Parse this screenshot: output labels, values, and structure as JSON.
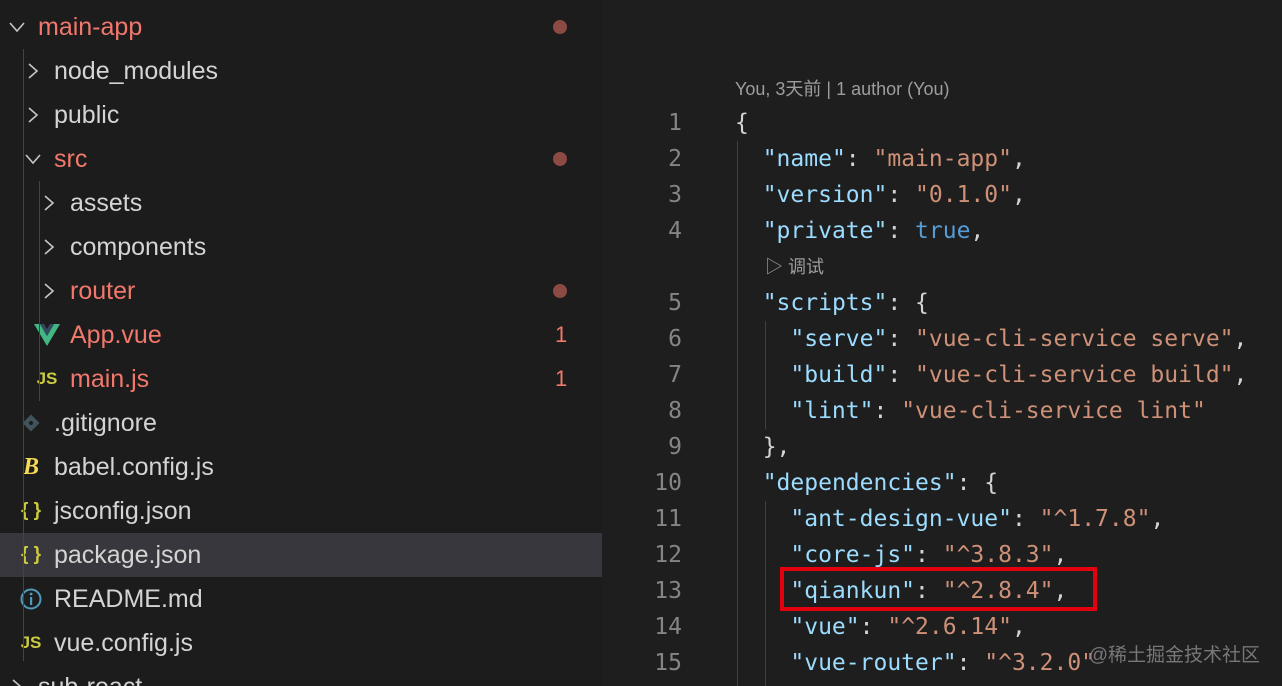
{
  "explorer": {
    "items": [
      {
        "name": "main-app",
        "kind": "folder-open",
        "level": 0,
        "modified": true,
        "dot": true
      },
      {
        "name": "node_modules",
        "kind": "folder",
        "level": 1
      },
      {
        "name": "public",
        "kind": "folder",
        "level": 1
      },
      {
        "name": "src",
        "kind": "folder-open",
        "level": 1,
        "modified": true,
        "dot": true
      },
      {
        "name": "assets",
        "kind": "folder",
        "level": 2
      },
      {
        "name": "components",
        "kind": "folder",
        "level": 2
      },
      {
        "name": "router",
        "kind": "folder",
        "level": 2,
        "modified": true,
        "dot": true
      },
      {
        "name": "App.vue",
        "kind": "vue",
        "level": 2,
        "modified": true,
        "count": "1"
      },
      {
        "name": "main.js",
        "kind": "js",
        "level": 2,
        "modified": true,
        "count": "1"
      },
      {
        "name": ".gitignore",
        "kind": "git",
        "level": 1
      },
      {
        "name": "babel.config.js",
        "kind": "babel",
        "level": 1
      },
      {
        "name": "jsconfig.json",
        "kind": "json",
        "level": 1
      },
      {
        "name": "package.json",
        "kind": "json",
        "level": 1,
        "selected": true
      },
      {
        "name": "README.md",
        "kind": "info",
        "level": 1
      },
      {
        "name": "vue.config.js",
        "kind": "js",
        "level": 1
      },
      {
        "name": "sub-react",
        "kind": "folder",
        "level": 0
      }
    ],
    "icon_glyphs": {
      "js": "JS",
      "json": "{ }",
      "info": "i",
      "babel": "B"
    }
  },
  "editor": {
    "blame": "You, 3天前 | 1 author (You)",
    "debug_lens": "▷ 调试",
    "lines": [
      {
        "n": "1",
        "tokens": [
          [
            "p",
            "{"
          ]
        ]
      },
      {
        "n": "2",
        "tokens": [
          [
            "p",
            "  "
          ],
          [
            "k",
            "\"name\""
          ],
          [
            "p",
            ": "
          ],
          [
            "s",
            "\"main-app\""
          ],
          [
            "p",
            ","
          ]
        ]
      },
      {
        "n": "3",
        "tokens": [
          [
            "p",
            "  "
          ],
          [
            "k",
            "\"version\""
          ],
          [
            "p",
            ": "
          ],
          [
            "s",
            "\"0.1.0\""
          ],
          [
            "p",
            ","
          ]
        ]
      },
      {
        "n": "4",
        "tokens": [
          [
            "p",
            "  "
          ],
          [
            "k",
            "\"private\""
          ],
          [
            "p",
            ": "
          ],
          [
            "b",
            "true"
          ],
          [
            "p",
            ","
          ]
        ]
      },
      {
        "n": "5",
        "tokens": [
          [
            "p",
            "  "
          ],
          [
            "k",
            "\"scripts\""
          ],
          [
            "p",
            ": {"
          ]
        ]
      },
      {
        "n": "6",
        "tokens": [
          [
            "p",
            "    "
          ],
          [
            "k",
            "\"serve\""
          ],
          [
            "p",
            ": "
          ],
          [
            "s",
            "\"vue-cli-service serve\""
          ],
          [
            "p",
            ","
          ]
        ]
      },
      {
        "n": "7",
        "tokens": [
          [
            "p",
            "    "
          ],
          [
            "k",
            "\"build\""
          ],
          [
            "p",
            ": "
          ],
          [
            "s",
            "\"vue-cli-service build\""
          ],
          [
            "p",
            ","
          ]
        ]
      },
      {
        "n": "8",
        "tokens": [
          [
            "p",
            "    "
          ],
          [
            "k",
            "\"lint\""
          ],
          [
            "p",
            ": "
          ],
          [
            "s",
            "\"vue-cli-service lint\""
          ]
        ]
      },
      {
        "n": "9",
        "tokens": [
          [
            "p",
            "  },"
          ]
        ]
      },
      {
        "n": "10",
        "tokens": [
          [
            "p",
            "  "
          ],
          [
            "k",
            "\"dependencies\""
          ],
          [
            "p",
            ": {"
          ]
        ]
      },
      {
        "n": "11",
        "tokens": [
          [
            "p",
            "    "
          ],
          [
            "k",
            "\"ant-design-vue\""
          ],
          [
            "p",
            ": "
          ],
          [
            "s",
            "\"^1.7.8\""
          ],
          [
            "p",
            ","
          ]
        ]
      },
      {
        "n": "12",
        "tokens": [
          [
            "p",
            "    "
          ],
          [
            "k",
            "\"core-js\""
          ],
          [
            "p",
            ": "
          ],
          [
            "s",
            "\"^3.8.3\""
          ],
          [
            "p",
            ","
          ]
        ]
      },
      {
        "n": "13",
        "tokens": [
          [
            "p",
            "    "
          ],
          [
            "k",
            "\"qiankun\""
          ],
          [
            "p",
            ": "
          ],
          [
            "s",
            "\"^2.8.4\""
          ],
          [
            "p",
            ","
          ]
        ]
      },
      {
        "n": "14",
        "tokens": [
          [
            "p",
            "    "
          ],
          [
            "k",
            "\"vue\""
          ],
          [
            "p",
            ": "
          ],
          [
            "s",
            "\"^2.6.14\""
          ],
          [
            "p",
            ","
          ]
        ]
      },
      {
        "n": "15",
        "tokens": [
          [
            "p",
            "    "
          ],
          [
            "k",
            "\"vue-router\""
          ],
          [
            "p",
            ": "
          ],
          [
            "s",
            "\"^3.2.0\""
          ]
        ]
      }
    ]
  },
  "watermark": "@稀土掘金技术社区",
  "colors": {
    "modified": "#f1786b",
    "key": "#9cdcfe",
    "string": "#ce9178",
    "boolean": "#569cd6",
    "highlight": "#e3000f",
    "vue_green": "#41b883",
    "js_yellow": "#cbcb41"
  }
}
